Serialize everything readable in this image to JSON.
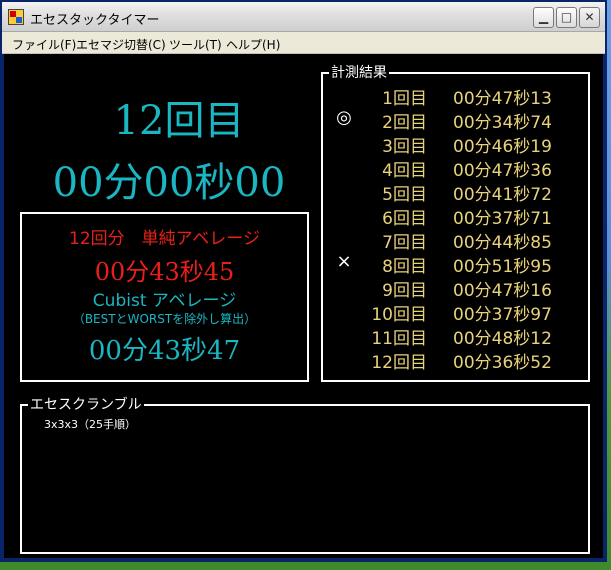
{
  "window": {
    "title": "エセスタックタイマー"
  },
  "menu": [
    {
      "label": "ファイル(F)"
    },
    {
      "label": "エセマジ切替(C)"
    },
    {
      "label": "ツール(T)"
    },
    {
      "label": "ヘルプ(H)"
    }
  ],
  "timer": {
    "count_label": "12回目",
    "current_time": "00分00秒00"
  },
  "averages": {
    "simple_label": "12回分　単純アベレージ",
    "simple_value": "00分43秒45",
    "cubist_label": "Cubist アベレージ",
    "cubist_note": "（BESTとWORSTを除外し算出）",
    "cubist_value": "00分43秒47"
  },
  "results": {
    "title": "計測結果",
    "rows": [
      {
        "mark": "",
        "index": "1回目",
        "time": "00分47秒13"
      },
      {
        "mark": "◎",
        "index": "2回目",
        "time": "00分34秒74"
      },
      {
        "mark": "",
        "index": "3回目",
        "time": "00分46秒19"
      },
      {
        "mark": "",
        "index": "4回目",
        "time": "00分47秒36"
      },
      {
        "mark": "",
        "index": "5回目",
        "time": "00分41秒72"
      },
      {
        "mark": "",
        "index": "6回目",
        "time": "00分37秒71"
      },
      {
        "mark": "",
        "index": "7回目",
        "time": "00分44秒85"
      },
      {
        "mark": "×",
        "index": "8回目",
        "time": "00分51秒95"
      },
      {
        "mark": "",
        "index": "9回目",
        "time": "00分47秒16"
      },
      {
        "mark": "",
        "index": "10回目",
        "time": "00分37秒97"
      },
      {
        "mark": "",
        "index": "11回目",
        "time": "00分48秒12"
      },
      {
        "mark": "",
        "index": "12回目",
        "time": "00分36秒52"
      }
    ]
  },
  "scramble": {
    "title": "エセスクランブル",
    "text": "3x3x3（25手順）"
  },
  "colors": {
    "cyan": "#1ab6c2",
    "red": "#e8201a",
    "gold": "#e8d27a"
  }
}
